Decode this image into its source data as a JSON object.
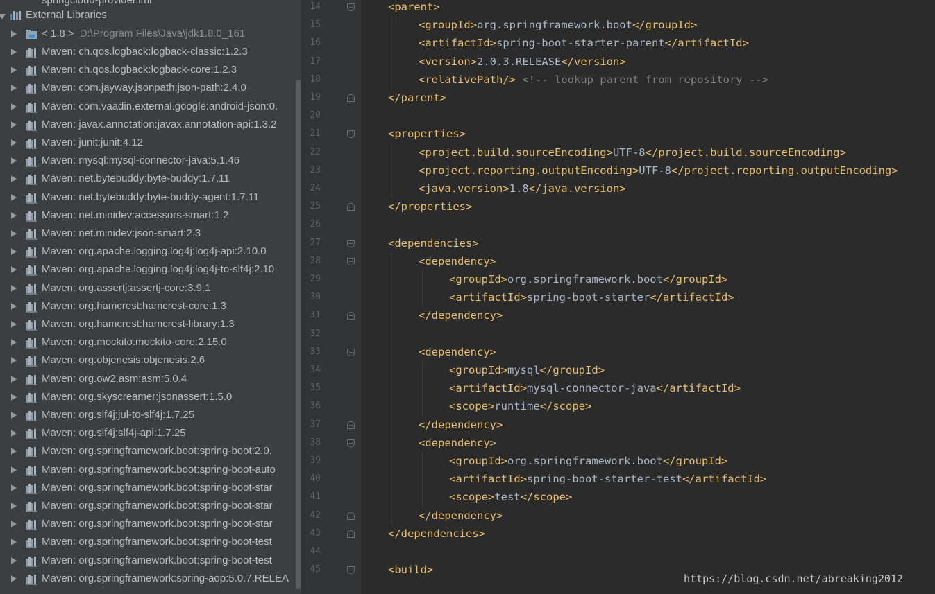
{
  "project_tree": {
    "partial_top_item": "springcloud-provider.iml",
    "root_label": "External Libraries",
    "jdk": {
      "name": "< 1.8 >",
      "path": "D:\\Program Files\\Java\\jdk1.8.0_161"
    },
    "libraries": [
      "Maven: ch.qos.logback:logback-classic:1.2.3",
      "Maven: ch.qos.logback:logback-core:1.2.3",
      "Maven: com.jayway.jsonpath:json-path:2.4.0",
      "Maven: com.vaadin.external.google:android-json:0.",
      "Maven: javax.annotation:javax.annotation-api:1.3.2",
      "Maven: junit:junit:4.12",
      "Maven: mysql:mysql-connector-java:5.1.46",
      "Maven: net.bytebuddy:byte-buddy:1.7.11",
      "Maven: net.bytebuddy:byte-buddy-agent:1.7.11",
      "Maven: net.minidev:accessors-smart:1.2",
      "Maven: net.minidev:json-smart:2.3",
      "Maven: org.apache.logging.log4j:log4j-api:2.10.0",
      "Maven: org.apache.logging.log4j:log4j-to-slf4j:2.10",
      "Maven: org.assertj:assertj-core:3.9.1",
      "Maven: org.hamcrest:hamcrest-core:1.3",
      "Maven: org.hamcrest:hamcrest-library:1.3",
      "Maven: org.mockito:mockito-core:2.15.0",
      "Maven: org.objenesis:objenesis:2.6",
      "Maven: org.ow2.asm:asm:5.0.4",
      "Maven: org.skyscreamer:jsonassert:1.5.0",
      "Maven: org.slf4j:jul-to-slf4j:1.7.25",
      "Maven: org.slf4j:slf4j-api:1.7.25",
      "Maven: org.springframework.boot:spring-boot:2.0.",
      "Maven: org.springframework.boot:spring-boot-auto",
      "Maven: org.springframework.boot:spring-boot-star",
      "Maven: org.springframework.boot:spring-boot-star",
      "Maven: org.springframework.boot:spring-boot-star",
      "Maven: org.springframework.boot:spring-boot-test",
      "Maven: org.springframework.boot:spring-boot-test",
      "Maven: org.springframework:spring-aop:5.0.7.RELEA"
    ]
  },
  "editor": {
    "lines": [
      {
        "n": "14",
        "indent": 1,
        "parts": [
          [
            "tag",
            "<parent>"
          ]
        ]
      },
      {
        "n": "15",
        "indent": 2,
        "parts": [
          [
            "tag",
            "<groupId>"
          ],
          [
            "text",
            "org.springframework.boot"
          ],
          [
            "tag",
            "</groupId>"
          ]
        ]
      },
      {
        "n": "16",
        "indent": 2,
        "parts": [
          [
            "tag",
            "<artifactId>"
          ],
          [
            "text",
            "spring-boot-starter-parent"
          ],
          [
            "tag",
            "</artifactId>"
          ]
        ]
      },
      {
        "n": "17",
        "indent": 2,
        "parts": [
          [
            "tag",
            "<version>"
          ],
          [
            "text",
            "2.0.3.RELEASE"
          ],
          [
            "tag",
            "</version>"
          ]
        ]
      },
      {
        "n": "18",
        "indent": 2,
        "parts": [
          [
            "tag",
            "<relativePath/>"
          ],
          [
            "text",
            " "
          ],
          [
            "comment",
            "<!-- lookup parent from repository -->"
          ]
        ]
      },
      {
        "n": "19",
        "indent": 1,
        "parts": [
          [
            "tag",
            "</parent>"
          ]
        ]
      },
      {
        "n": "20",
        "indent": 0,
        "parts": []
      },
      {
        "n": "21",
        "indent": 1,
        "parts": [
          [
            "tag",
            "<properties>"
          ]
        ]
      },
      {
        "n": "22",
        "indent": 2,
        "parts": [
          [
            "tag",
            "<project.build.sourceEncoding>"
          ],
          [
            "text",
            "UTF-8"
          ],
          [
            "tag",
            "</project.build.sourceEncoding>"
          ]
        ]
      },
      {
        "n": "23",
        "indent": 2,
        "parts": [
          [
            "tag",
            "<project.reporting.outputEncoding>"
          ],
          [
            "text",
            "UTF-8"
          ],
          [
            "tag",
            "</project.reporting.outputEncoding>"
          ]
        ]
      },
      {
        "n": "24",
        "indent": 2,
        "parts": [
          [
            "tag",
            "<java.version>"
          ],
          [
            "text",
            "1.8"
          ],
          [
            "tag",
            "</java.version>"
          ]
        ]
      },
      {
        "n": "25",
        "indent": 1,
        "parts": [
          [
            "tag",
            "</properties>"
          ]
        ]
      },
      {
        "n": "26",
        "indent": 0,
        "parts": []
      },
      {
        "n": "27",
        "indent": 1,
        "parts": [
          [
            "tag",
            "<dependencies>"
          ]
        ]
      },
      {
        "n": "28",
        "indent": 2,
        "parts": [
          [
            "tag",
            "<dependency>"
          ]
        ]
      },
      {
        "n": "29",
        "indent": 3,
        "parts": [
          [
            "tag",
            "<groupId>"
          ],
          [
            "text",
            "org.springframework.boot"
          ],
          [
            "tag",
            "</groupId>"
          ]
        ]
      },
      {
        "n": "30",
        "indent": 3,
        "parts": [
          [
            "tag",
            "<artifactId>"
          ],
          [
            "text",
            "spring-boot-starter"
          ],
          [
            "tag",
            "</artifactId>"
          ]
        ]
      },
      {
        "n": "31",
        "indent": 2,
        "parts": [
          [
            "tag",
            "</dependency>"
          ]
        ]
      },
      {
        "n": "32",
        "indent": 0,
        "parts": []
      },
      {
        "n": "33",
        "indent": 2,
        "parts": [
          [
            "tag",
            "<dependency>"
          ]
        ]
      },
      {
        "n": "34",
        "indent": 3,
        "parts": [
          [
            "tag",
            "<groupId>"
          ],
          [
            "text",
            "mysql"
          ],
          [
            "tag",
            "</groupId>"
          ]
        ]
      },
      {
        "n": "35",
        "indent": 3,
        "parts": [
          [
            "tag",
            "<artifactId>"
          ],
          [
            "text",
            "mysql-connector-java"
          ],
          [
            "tag",
            "</artifactId>"
          ]
        ]
      },
      {
        "n": "36",
        "indent": 3,
        "parts": [
          [
            "tag",
            "<scope>"
          ],
          [
            "text",
            "runtime"
          ],
          [
            "tag",
            "</scope>"
          ]
        ]
      },
      {
        "n": "37",
        "indent": 2,
        "parts": [
          [
            "tag",
            "</dependency>"
          ]
        ]
      },
      {
        "n": "38",
        "indent": 2,
        "parts": [
          [
            "tag",
            "<dependency>"
          ]
        ]
      },
      {
        "n": "39",
        "indent": 3,
        "parts": [
          [
            "tag",
            "<groupId>"
          ],
          [
            "text",
            "org.springframework.boot"
          ],
          [
            "tag",
            "</groupId>"
          ]
        ]
      },
      {
        "n": "40",
        "indent": 3,
        "parts": [
          [
            "tag",
            "<artifactId>"
          ],
          [
            "text",
            "spring-boot-starter-test"
          ],
          [
            "tag",
            "</artifactId>"
          ]
        ]
      },
      {
        "n": "41",
        "indent": 3,
        "parts": [
          [
            "tag",
            "<scope>"
          ],
          [
            "text",
            "test"
          ],
          [
            "tag",
            "</scope>"
          ]
        ]
      },
      {
        "n": "42",
        "indent": 2,
        "parts": [
          [
            "tag",
            "</dependency>"
          ]
        ]
      },
      {
        "n": "43",
        "indent": 1,
        "parts": [
          [
            "tag",
            "</dependencies>"
          ]
        ]
      },
      {
        "n": "44",
        "indent": 0,
        "parts": []
      },
      {
        "n": "45",
        "indent": 1,
        "parts": [
          [
            "tag",
            "<build>"
          ]
        ]
      }
    ],
    "colors": {
      "tag": "#e8bf6a",
      "text": "#a9b7c6",
      "comment": "#808080",
      "background": "#2b2b2b",
      "gutter": "#313335"
    }
  },
  "watermark": "https://blog.csdn.net/abreaking2012"
}
